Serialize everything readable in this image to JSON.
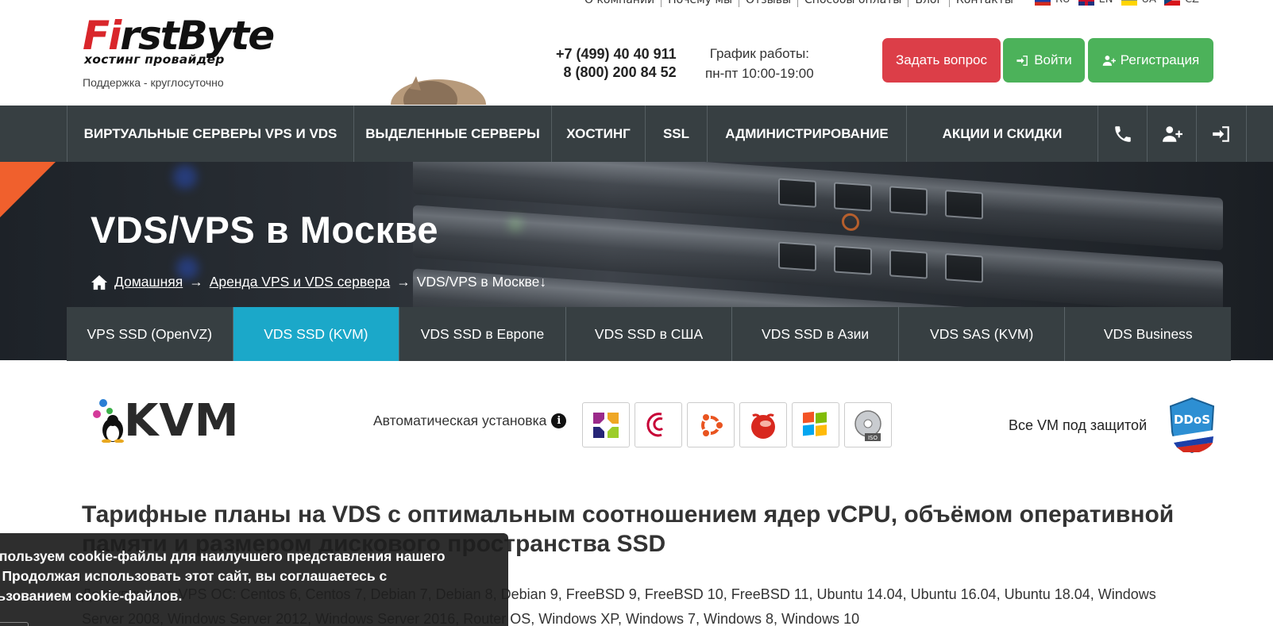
{
  "topnav": [
    "О компании",
    "Почему мы",
    "Отзывы",
    "Способы оплаты",
    "Блог",
    "Контакты"
  ],
  "langs": [
    "RU",
    "EN",
    "UA",
    "CZ"
  ],
  "logo": {
    "part1": "F",
    "part1b": "i",
    "part2": "rstByte",
    "sub": "хостинг провайдер"
  },
  "support": "Поддержка - круглосуточно",
  "phones": [
    "+7 (499) 40 40 911",
    "8 (800) 200 84 52"
  ],
  "schedule": [
    "График работы:",
    "пн-пт 10:00-19:00"
  ],
  "buttons": {
    "ask": "Задать вопрос",
    "login": "Войти",
    "register": "Регистрация"
  },
  "mainnav": [
    "ВИРТУАЛЬНЫЕ СЕРВЕРЫ VPS И VDS",
    "ВЫДЕЛЕННЫЕ СЕРВЕРЫ",
    "ХОСТИНГ",
    "SSL",
    "АДМИНИСТРИРОВАНИЕ",
    "АКЦИИ И СКИДКИ"
  ],
  "hero": {
    "title": "VDS/VPS в Москве",
    "crumbs": [
      "Домашняя",
      "Аренда VPS и VDS сервера",
      "VDS/VPS в Москве"
    ],
    "arrow": "→",
    "down": "↓"
  },
  "subtabs": [
    "VPS SSD (OpenVZ)",
    "VDS SSD (KVM)",
    "VDS SSD в Европе",
    "VDS SSD в США",
    "VDS SSD в Азии",
    "VDS SAS (KVM)",
    "VDS Business"
  ],
  "active_subtab": 1,
  "kvm": "KVM",
  "auto_install": "Автоматическая установка",
  "os_icons": [
    "centos-icon",
    "debian-icon",
    "ubuntu-icon",
    "freebsd-icon",
    "windows-icon",
    "iso-icon"
  ],
  "ddos_label": "Все VM под защитой",
  "ddos_badge": "DDoS",
  "heading": "Тарифные планы на VDS с оптимальным соотношением ядер vCPU, объёмом оперативной памяти и размером дискового пространства SSD",
  "os_text": "Доступные на VPS ОС: Centos 6, Centos 7, Debian 7, Debian 8, Debian 9, FreeBSD 9, FreeBSD 10, FreeBSD 11, Ubuntu 14.04, Ubuntu 16.04, Ubuntu 18.04, Windows Server 2008, Windows Server 2012, Windows Server 2016, Router OS, Windows XP, Windows 7, Windows 8, Windows 10",
  "cookie": "Мы используем cookie-файлы для наилучшего представления нашего сайта. Продолжая использовать этот сайт, вы соглашаетесь с использованием cookie-файлов.",
  "colors": {
    "nav": "#373f42",
    "active_tab": "#1ba8c9",
    "ask": "#dc3e48",
    "green": "#4cb25a",
    "accent": "#f0602d"
  }
}
